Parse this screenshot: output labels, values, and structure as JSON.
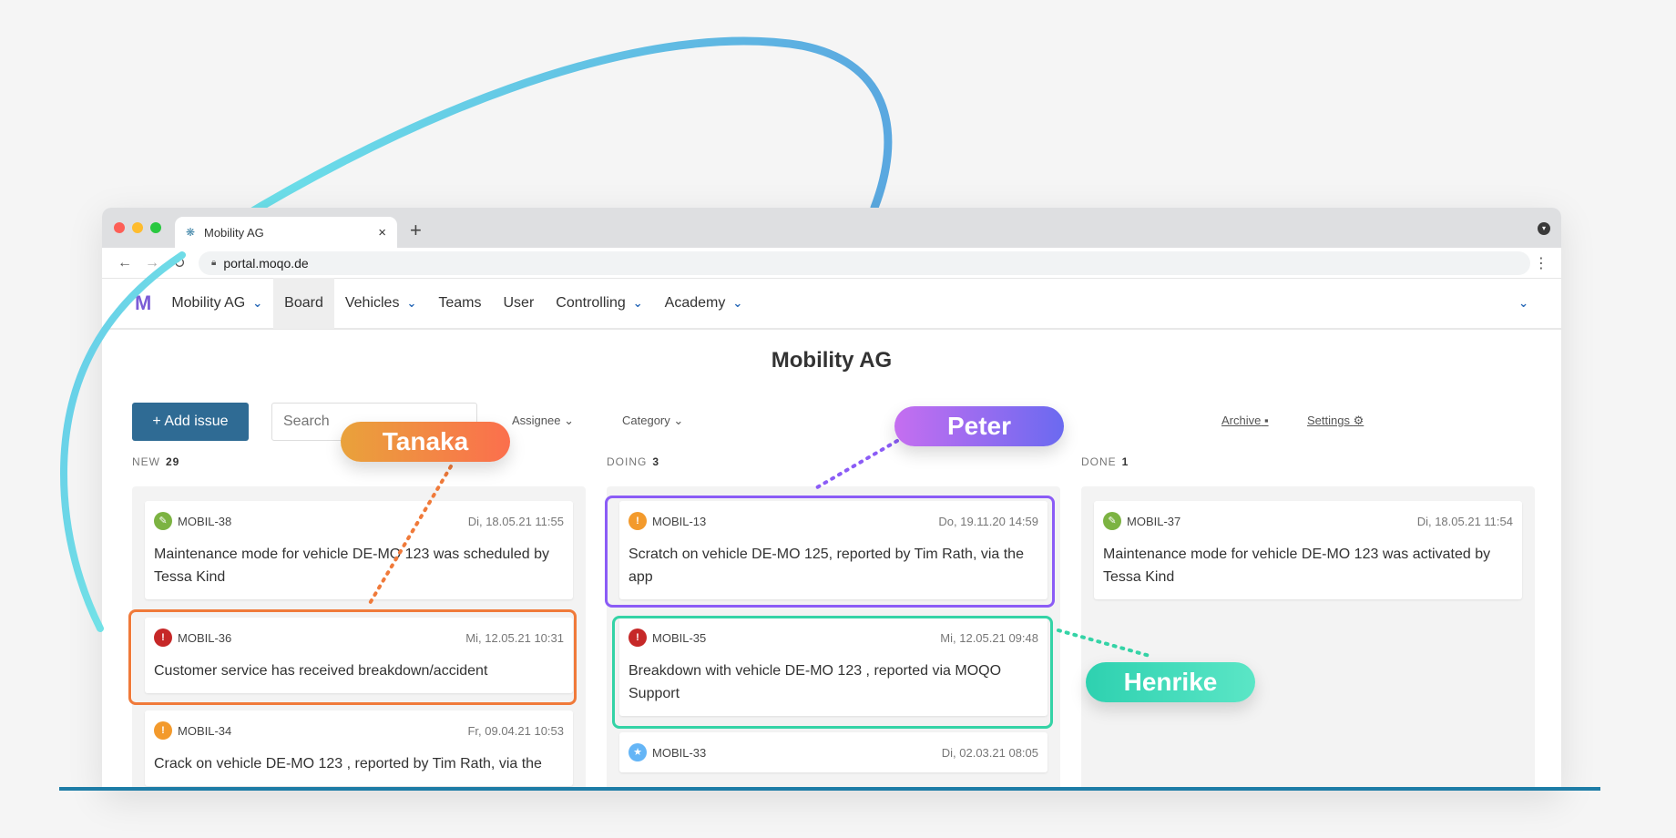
{
  "browser": {
    "tab_title": "Mobility AG",
    "url": "portal.moqo.de"
  },
  "appnav": {
    "org": "Mobility AG",
    "items": [
      {
        "label": "Board"
      },
      {
        "label": "Vehicles"
      },
      {
        "label": "Teams"
      },
      {
        "label": "User"
      },
      {
        "label": "Controlling"
      },
      {
        "label": "Academy"
      }
    ]
  },
  "page_title": "Mobility AG",
  "toolbar": {
    "add_label": "+ Add issue",
    "search_placeholder": "Search",
    "assignee": "Assignee",
    "category": "Category",
    "archive": "Archive",
    "settings": "Settings"
  },
  "columns": [
    {
      "name": "NEW",
      "count": "29",
      "cards": [
        {
          "id": "MOBIL-38",
          "date": "Di, 18.05.21 11:55",
          "text": "Maintenance mode for vehicle DE-MO 123 was scheduled by Tessa Kind",
          "icon": "wrench-icon",
          "color": "#7cb342"
        },
        {
          "id": "MOBIL-36",
          "date": "Mi, 12.05.21 10:31",
          "text": "Customer service has received breakdown/accident",
          "icon": "shield-icon",
          "color": "#c62828"
        },
        {
          "id": "MOBIL-34",
          "date": "Fr, 09.04.21 10:53",
          "text": "Crack on vehicle DE-MO 123 , reported by Tim Rath, via the",
          "icon": "warning-icon",
          "color": "#f39a2c"
        }
      ]
    },
    {
      "name": "DOING",
      "count": "3",
      "cards": [
        {
          "id": "MOBIL-13",
          "date": "Do, 19.11.20 14:59",
          "text": "Scratch on vehicle DE-MO 125, reported by Tim Rath, via the app",
          "icon": "warning-icon",
          "color": "#f39a2c"
        },
        {
          "id": "MOBIL-35",
          "date": "Mi, 12.05.21 09:48",
          "text": "Breakdown with vehicle DE-MO 123 , reported via MOQO Support",
          "icon": "shield-icon",
          "color": "#c62828"
        },
        {
          "id": "MOBIL-33",
          "date": "Di, 02.03.21 08:05",
          "text": "",
          "icon": "star-icon",
          "color": "#64b5f6"
        }
      ]
    },
    {
      "name": "DONE",
      "count": "1",
      "cards": [
        {
          "id": "MOBIL-37",
          "date": "Di, 18.05.21 11:54",
          "text": "Maintenance mode for vehicle DE-MO 123 was activated by Tessa Kind",
          "icon": "wrench-icon",
          "color": "#7cb342"
        }
      ]
    }
  ],
  "annotations": {
    "tanaka": "Tanaka",
    "peter": "Peter",
    "henrike": "Henrike"
  },
  "colors": {
    "primary": "#2f6b94",
    "tanaka": "#f07a3a",
    "peter": "#8b5cf6",
    "henrike": "#34d3a6"
  }
}
